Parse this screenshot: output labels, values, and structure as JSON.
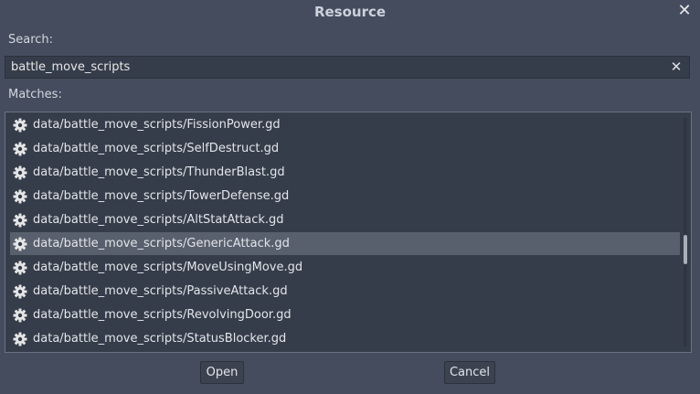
{
  "dialog": {
    "title": "Resource"
  },
  "search": {
    "label": "Search:",
    "value": "battle_move_scripts"
  },
  "matches": {
    "label": "Matches:",
    "items": [
      "data/battle_move_scripts/FissionPower.gd",
      "data/battle_move_scripts/SelfDestruct.gd",
      "data/battle_move_scripts/ThunderBlast.gd",
      "data/battle_move_scripts/TowerDefense.gd",
      "data/battle_move_scripts/AltStatAttack.gd",
      "data/battle_move_scripts/GenericAttack.gd",
      "data/battle_move_scripts/MoveUsingMove.gd",
      "data/battle_move_scripts/PassiveAttack.gd",
      "data/battle_move_scripts/RevolvingDoor.gd",
      "data/battle_move_scripts/StatusBlocker.gd"
    ],
    "selected": "data/battle_move_scripts/GenericAttack.gd",
    "item_icon": "gear-icon"
  },
  "buttons": {
    "open": "Open",
    "cancel": "Cancel"
  },
  "icons": {
    "close": "close-icon",
    "clear": "clear-icon"
  }
}
